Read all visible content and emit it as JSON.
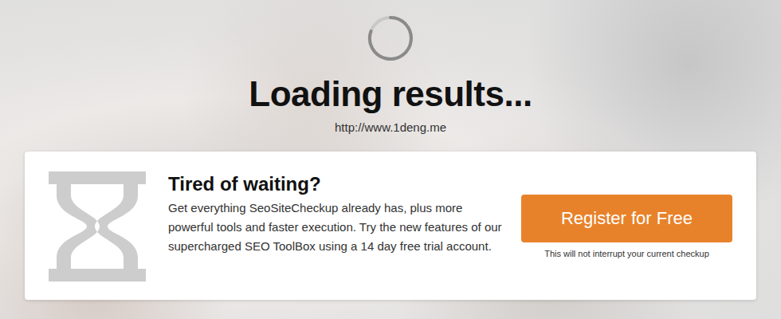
{
  "page": {
    "status": "Loading results...",
    "url": "http://www.1deng.me"
  },
  "promo": {
    "title": "Tired of waiting?",
    "body": "Get everything SeoSiteCheckup already has, plus more powerful tools and faster execution. Try the new features of our supercharged SEO ToolBox using a 14 day free trial account.",
    "button": "Register for Free",
    "note": "This will not interrupt your current checkup"
  }
}
